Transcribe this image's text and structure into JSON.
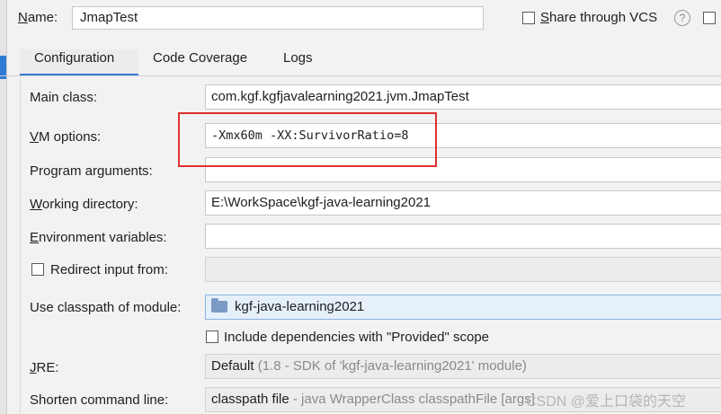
{
  "header": {
    "name_label": "Name:",
    "name_value": "JmapTest",
    "share_label": "Share through VCS",
    "help_glyph": "?"
  },
  "tabs": [
    {
      "label": "Configuration",
      "active": true
    },
    {
      "label": "Code Coverage",
      "active": false
    },
    {
      "label": "Logs",
      "active": false
    }
  ],
  "form": {
    "main_class": {
      "label": "Main class:",
      "value": "com.kgf.kgfjavalearning2021.jvm.JmapTest"
    },
    "vm_options": {
      "label": "VM options:",
      "value": "-Xmx60m -XX:SurvivorRatio=8"
    },
    "program_arguments": {
      "label": "Program arguments:",
      "value": ""
    },
    "working_directory": {
      "label": "Working directory:",
      "value": "E:\\WorkSpace\\kgf-java-learning2021"
    },
    "environment_variables": {
      "label": "Environment variables:",
      "value": ""
    },
    "redirect_input": {
      "label": "Redirect input from:",
      "value": ""
    },
    "classpath_module": {
      "label": "Use classpath of module:",
      "value": "kgf-java-learning2021",
      "icon": "module-folder-icon"
    },
    "include_dependencies": {
      "label": "Include dependencies with \"Provided\" scope"
    },
    "jre": {
      "label": "JRE:",
      "value": "Default",
      "detail": "(1.8 - SDK of 'kgf-java-learning2021' module)"
    },
    "shorten_command_line": {
      "label": "Shorten command line:",
      "value": "classpath file",
      "detail": "- java WrapperClass classpathFile [args]"
    }
  },
  "watermark": "CSDN @爱上口袋的天空",
  "colors": {
    "accent": "#3a7bd5",
    "highlight": "#e03030"
  }
}
